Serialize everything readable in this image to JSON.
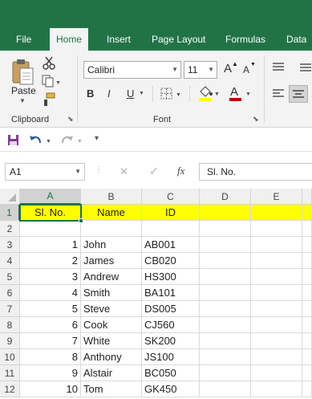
{
  "tabs": [
    "File",
    "Home",
    "Insert",
    "Page Layout",
    "Formulas",
    "Data"
  ],
  "active_tab": "Home",
  "clipboard": {
    "paste_label": "Paste",
    "group_label": "Clipboard"
  },
  "font": {
    "name": "Calibri",
    "size": "11",
    "bold": "B",
    "italic": "I",
    "underline": "U",
    "grow": "A",
    "shrink": "A",
    "group_label": "Font"
  },
  "colors": {
    "accent": "#217346",
    "highlight": "#ffff00",
    "font_color": "#c00000",
    "fill_color": "#ffff00"
  },
  "formula_bar": {
    "name_box": "A1",
    "cancel": "✕",
    "enter": "✓",
    "fx": "fx",
    "formula": "Sl. No."
  },
  "columns": [
    "A",
    "B",
    "C",
    "D",
    "E"
  ],
  "rows": [
    "1",
    "2",
    "3",
    "4",
    "5",
    "6",
    "7",
    "8",
    "9",
    "10",
    "11",
    "12"
  ],
  "header": {
    "a": "Sl. No.",
    "b": "Name",
    "c": "ID"
  },
  "records": [
    {
      "n": "1",
      "name": "John",
      "id": "AB001"
    },
    {
      "n": "2",
      "name": "James",
      "id": "CB020"
    },
    {
      "n": "3",
      "name": "Andrew",
      "id": "HS300"
    },
    {
      "n": "4",
      "name": "Smith",
      "id": "BA101"
    },
    {
      "n": "5",
      "name": "Steve",
      "id": "DS005"
    },
    {
      "n": "6",
      "name": "Cook",
      "id": "CJ560"
    },
    {
      "n": "7",
      "name": "White",
      "id": "SK200"
    },
    {
      "n": "8",
      "name": "Anthony",
      "id": "JS100"
    },
    {
      "n": "9",
      "name": "Alstair",
      "id": "BC050"
    },
    {
      "n": "10",
      "name": "Tom",
      "id": "GK450"
    }
  ]
}
